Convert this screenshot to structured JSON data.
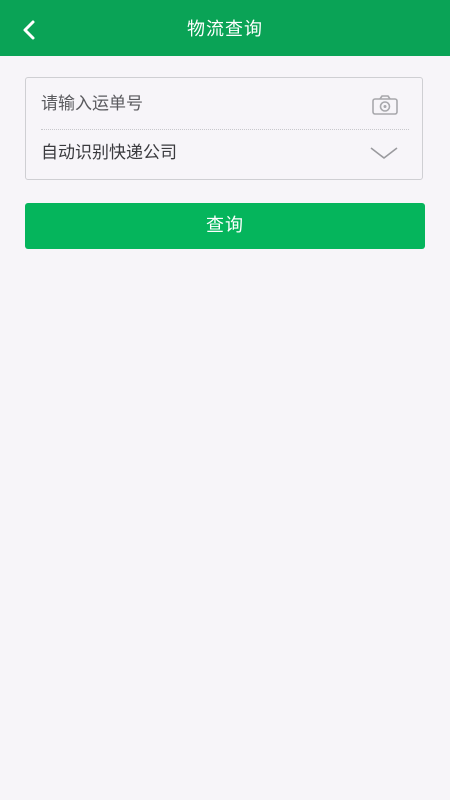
{
  "header": {
    "title": "物流查询",
    "background_color": "#0aa356",
    "back_icon": "chevron-left-icon"
  },
  "form": {
    "tracking_number": {
      "value": "",
      "placeholder": "请输入运单号",
      "scan_icon": "camera-icon"
    },
    "courier_company": {
      "selected_label": "自动识别快递公司",
      "dropdown_icon": "chevron-down-icon"
    }
  },
  "actions": {
    "query_label": "查询",
    "query_color": "#05b55c"
  }
}
